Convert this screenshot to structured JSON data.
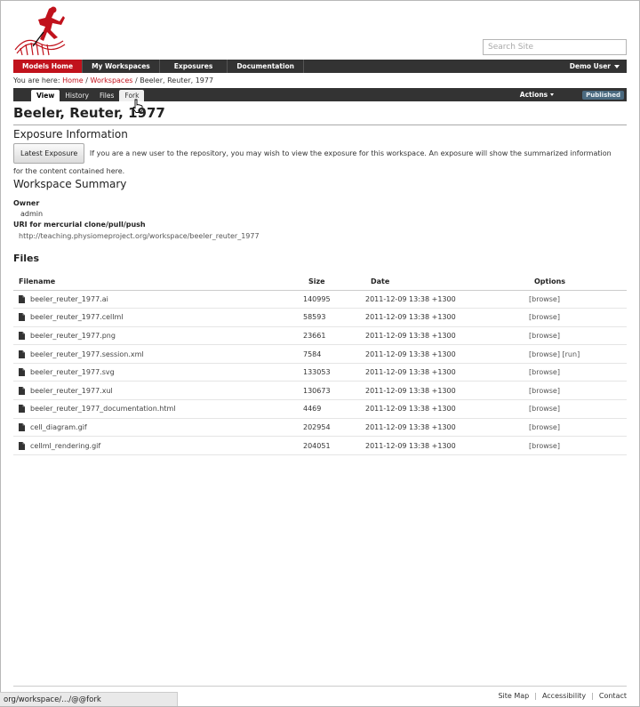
{
  "search": {
    "placeholder": "Search Site"
  },
  "main_nav": {
    "items": [
      "Models Home",
      "My Workspaces",
      "Exposures",
      "Documentation"
    ],
    "user_menu": "Demo User"
  },
  "breadcrumb": {
    "prefix": "You are here:",
    "home": "Home",
    "sep": "/",
    "workspaces": "Workspaces",
    "current": "Beeler, Reuter, 1977"
  },
  "tabs": [
    "View",
    "History",
    "Files",
    "Fork"
  ],
  "actions_label": "Actions",
  "status_badge": "Published",
  "page_title": "Beeler, Reuter, 1977",
  "exposure": {
    "heading": "Exposure Information",
    "button": "Latest Exposure",
    "text": "If you are a new user to the repository, you may wish to view the exposure for this workspace. An exposure will show the summarized information for the content contained here."
  },
  "summary": {
    "heading": "Workspace Summary",
    "owner_label": "Owner",
    "owner": "admin",
    "uri_label": "URI for mercurial clone/pull/push",
    "uri": "http://teaching.physiomeproject.org/workspace/beeler_reuter_1977"
  },
  "files": {
    "heading": "Files",
    "columns": {
      "name": "Filename",
      "size": "Size",
      "date": "Date",
      "options": "Options"
    },
    "rows": [
      {
        "name": "beeler_reuter_1977.ai",
        "size": "140995",
        "date": "2011-12-09 13:38 +1300",
        "options": "[browse]"
      },
      {
        "name": "beeler_reuter_1977.cellml",
        "size": "58593",
        "date": "2011-12-09 13:38 +1300",
        "options": "[browse]"
      },
      {
        "name": "beeler_reuter_1977.png",
        "size": "23661",
        "date": "2011-12-09 13:38 +1300",
        "options": "[browse]"
      },
      {
        "name": "beeler_reuter_1977.session.xml",
        "size": "7584",
        "date": "2011-12-09 13:38 +1300",
        "options": "[browse]",
        "options2": "[run]"
      },
      {
        "name": "beeler_reuter_1977.svg",
        "size": "133053",
        "date": "2011-12-09 13:38 +1300",
        "options": "[browse]"
      },
      {
        "name": "beeler_reuter_1977.xul",
        "size": "130673",
        "date": "2011-12-09 13:38 +1300",
        "options": "[browse]"
      },
      {
        "name": "beeler_reuter_1977_documentation.html",
        "size": "4469",
        "date": "2011-12-09 13:38 +1300",
        "options": "[browse]"
      },
      {
        "name": "cell_diagram.gif",
        "size": "202954",
        "date": "2011-12-09 13:38 +1300",
        "options": "[browse]"
      },
      {
        "name": "cellml_rendering.gif",
        "size": "204051",
        "date": "2011-12-09 13:38 +1300",
        "options": "[browse]"
      }
    ]
  },
  "footer": {
    "links": [
      "Site Map",
      "Accessibility",
      "Contact"
    ]
  },
  "status_bar": "org/workspace/.../@@fork",
  "colors": {
    "accent": "#c1121c",
    "nav_bg": "#333333",
    "badge_bg": "#4b6a80"
  },
  "icons": {
    "logo": "physiome-runner-logo",
    "file": "file-icon",
    "cursor": "hand-pointer-icon",
    "caret": "caret-down-icon"
  }
}
